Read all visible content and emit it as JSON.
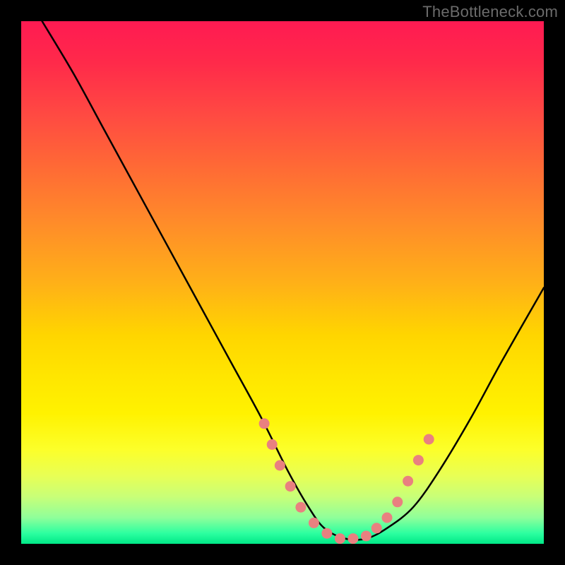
{
  "watermark": "TheBottleneck.com",
  "chart_data": {
    "type": "line",
    "title": "",
    "xlabel": "",
    "ylabel": "",
    "xlim": [
      0,
      100
    ],
    "ylim": [
      0,
      100
    ],
    "series": [
      {
        "name": "bottleneck-curve",
        "x": [
          4,
          10,
          16,
          22,
          28,
          34,
          40,
          46,
          51,
          55,
          58,
          62,
          66,
          70,
          75,
          80,
          86,
          92,
          100
        ],
        "y": [
          100,
          90,
          79,
          68,
          57,
          46,
          35,
          24,
          14,
          7,
          3,
          1,
          1,
          3,
          7,
          14,
          24,
          35,
          49
        ]
      }
    ],
    "markers": {
      "name": "highlight-dots",
      "color": "#e98080",
      "points": [
        {
          "x": 46.5,
          "y": 23
        },
        {
          "x": 48.0,
          "y": 19
        },
        {
          "x": 49.5,
          "y": 15
        },
        {
          "x": 51.5,
          "y": 11
        },
        {
          "x": 53.5,
          "y": 7
        },
        {
          "x": 56.0,
          "y": 4
        },
        {
          "x": 58.5,
          "y": 2
        },
        {
          "x": 61.0,
          "y": 1
        },
        {
          "x": 63.5,
          "y": 1
        },
        {
          "x": 66.0,
          "y": 1.5
        },
        {
          "x": 68.0,
          "y": 3
        },
        {
          "x": 70.0,
          "y": 5
        },
        {
          "x": 72.0,
          "y": 8
        },
        {
          "x": 74.0,
          "y": 12
        },
        {
          "x": 76.0,
          "y": 16
        },
        {
          "x": 78.0,
          "y": 20
        }
      ]
    },
    "gradient_stops": [
      {
        "pos": 0,
        "color": "#ff1a52"
      },
      {
        "pos": 50,
        "color": "#ffb018"
      },
      {
        "pos": 75,
        "color": "#fff200"
      },
      {
        "pos": 100,
        "color": "#00e887"
      }
    ]
  }
}
